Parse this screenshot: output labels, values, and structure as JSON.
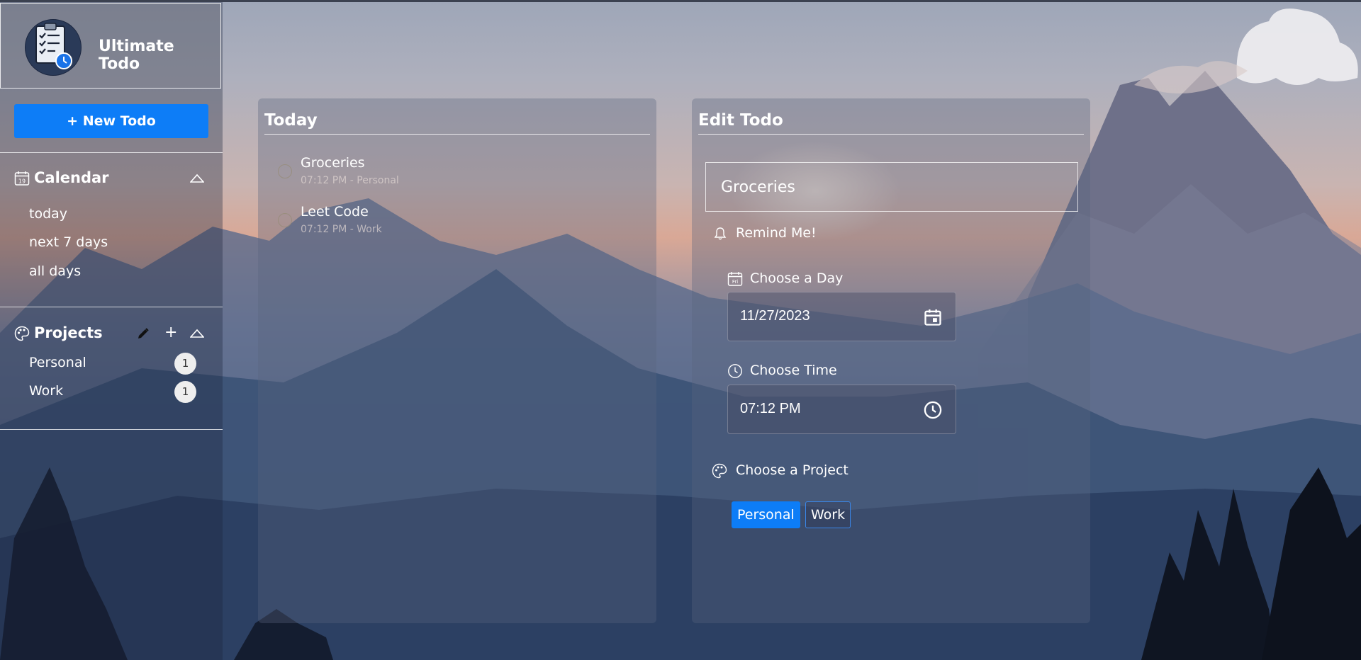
{
  "app": {
    "title": "Ultimate Todo"
  },
  "sidebar": {
    "new_todo_label": "+ New Todo",
    "calendar": {
      "title": "Calendar",
      "icon_day": "19",
      "items": [
        {
          "label": "today"
        },
        {
          "label": "next 7 days"
        },
        {
          "label": "all days"
        }
      ]
    },
    "projects": {
      "title": "Projects",
      "add_label": "+",
      "items": [
        {
          "label": "Personal",
          "count": "1"
        },
        {
          "label": "Work",
          "count": "1"
        }
      ]
    }
  },
  "today_panel": {
    "title": "Today",
    "todos": [
      {
        "name": "Groceries",
        "meta": "07:12 PM - Personal"
      },
      {
        "name": "Leet Code",
        "meta": "07:12 PM - Work"
      }
    ]
  },
  "edit_panel": {
    "title": "Edit Todo",
    "todo_text": "Groceries",
    "remind_label": "Remind Me!",
    "day_label": "Choose a Day",
    "day_icon_text": "Fri",
    "day_value": "11/27/2023",
    "time_label": "Choose Time",
    "time_value": "07:12 PM",
    "project_label": "Choose a Project",
    "projects": [
      {
        "label": "Personal",
        "selected": true
      },
      {
        "label": "Work",
        "selected": false
      }
    ]
  },
  "colors": {
    "accent": "#0d7df7",
    "badge_bg": "#eeeeee"
  },
  "icons": {
    "logo": "clipboard-checklist-icon",
    "calendar": "calendar-icon",
    "projects": "palette-icon",
    "edit": "pencil-icon",
    "collapse": "chevron-up-icon",
    "remind": "bell-icon",
    "day": "calendar-day-icon",
    "time": "clock-icon",
    "date_picker": "calendar-picker-icon"
  }
}
